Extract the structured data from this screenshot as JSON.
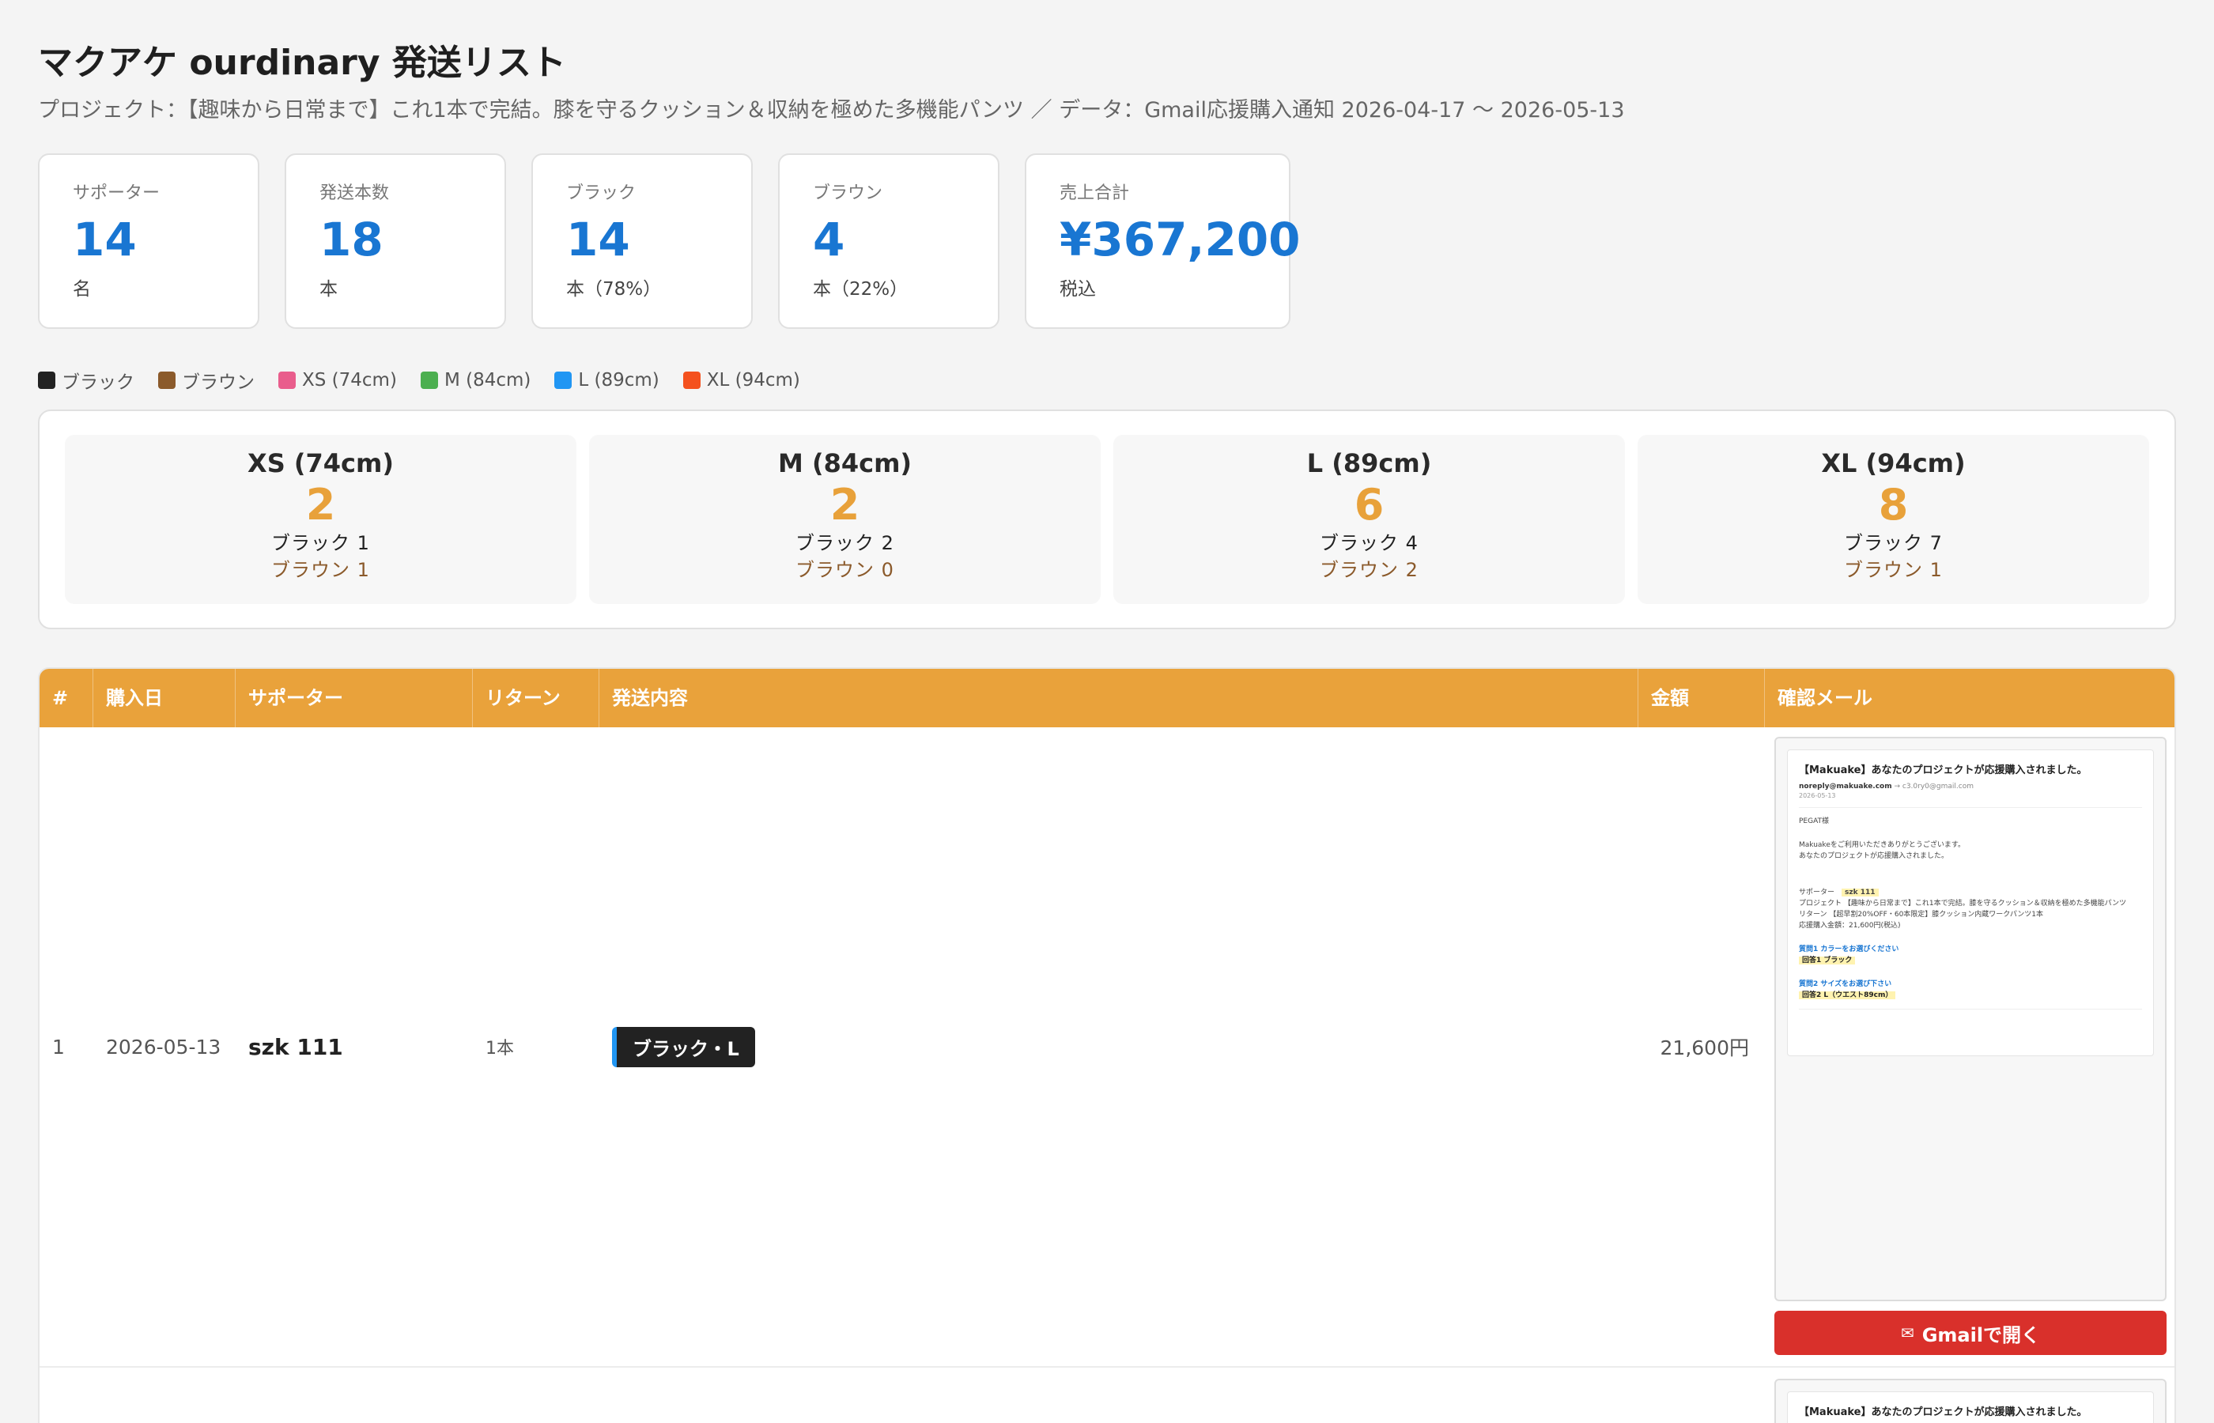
{
  "header": {
    "title": "マクアケ ourdinary 発送リスト",
    "subtitle": "プロジェクト：【趣味から日常まで】これ1本で完結。膝を守るクッション＆収納を極めた多機能パンツ ／ データ：Gmail応援購入通知 2026-04-17 〜 2026-05-13"
  },
  "stats": [
    {
      "label": "サポーター",
      "value": "14",
      "unit": "名"
    },
    {
      "label": "発送本数",
      "value": "18",
      "unit": "本"
    },
    {
      "label": "ブラック",
      "value": "14",
      "unit": "本（78%）"
    },
    {
      "label": "ブラウン",
      "value": "4",
      "unit": "本（22%）"
    },
    {
      "label": "売上合計",
      "value": "¥367,200",
      "unit": "税込"
    }
  ],
  "legend": [
    {
      "label": "ブラック",
      "color": "#222222"
    },
    {
      "label": "ブラウン",
      "color": "#8b5a2b"
    },
    {
      "label": "XS (74cm)",
      "color": "#e95d8c"
    },
    {
      "label": "M (84cm)",
      "color": "#4caf50"
    },
    {
      "label": "L (89cm)",
      "color": "#2196f3"
    },
    {
      "label": "XL (94cm)",
      "color": "#f4511e"
    }
  ],
  "sizes": [
    {
      "name": "XS (74cm)",
      "count": "2",
      "black": "ブラック 1",
      "brown": "ブラウン 1"
    },
    {
      "name": "M (84cm)",
      "count": "2",
      "black": "ブラック 2",
      "brown": "ブラウン 0"
    },
    {
      "name": "L (89cm)",
      "count": "6",
      "black": "ブラック 4",
      "brown": "ブラウン 2"
    },
    {
      "name": "XL (94cm)",
      "count": "8",
      "black": "ブラック 7",
      "brown": "ブラウン 1"
    }
  ],
  "table": {
    "headers": [
      "#",
      "購入日",
      "サポーター",
      "リターン",
      "発送内容",
      "金額",
      "確認メール"
    ],
    "rows": [
      {
        "num": "1",
        "date": "2026-05-13",
        "supporter": "szk 111",
        "return": "1本",
        "content": "ブラック・L",
        "amount": "21,600円",
        "button": "Gmailで開く",
        "mail": {
          "subject": "【Makuake】あなたのプロジェクトが応援購入されました。",
          "from": "noreply@makuake.com",
          "to": "→ c3.0ry0@gmail.com",
          "date": "2026-05-13",
          "greeting": "PEGAT様",
          "body1": "Makuakeをご利用いただきありがとうございます。",
          "body2": "あなたのプロジェクトが応援購入されました。",
          "supporter_label": "サポーター",
          "supporter_value": "szk 111",
          "project_line": "プロジェクト 【趣味から日常まで】これ1本で完結。膝を守るクッション＆収納を極めた多機能パンツ",
          "return_line": "リターン 【超早割20%OFF・60本限定】膝クッション内蔵ワークパンツ1本",
          "amount_line": "応援購入金額：21,600円(税込)",
          "q1": "質問1 カラーをお選びください",
          "a1": "回答1 ブラック",
          "q2": "質問2 サイズをお選び下さい",
          "a2": "回答2 L（ウエスト89cm）"
        }
      },
      {
        "mail": {
          "subject": "【Makuake】あなたのプロジェクトが応援購入されました。"
        }
      }
    ]
  }
}
